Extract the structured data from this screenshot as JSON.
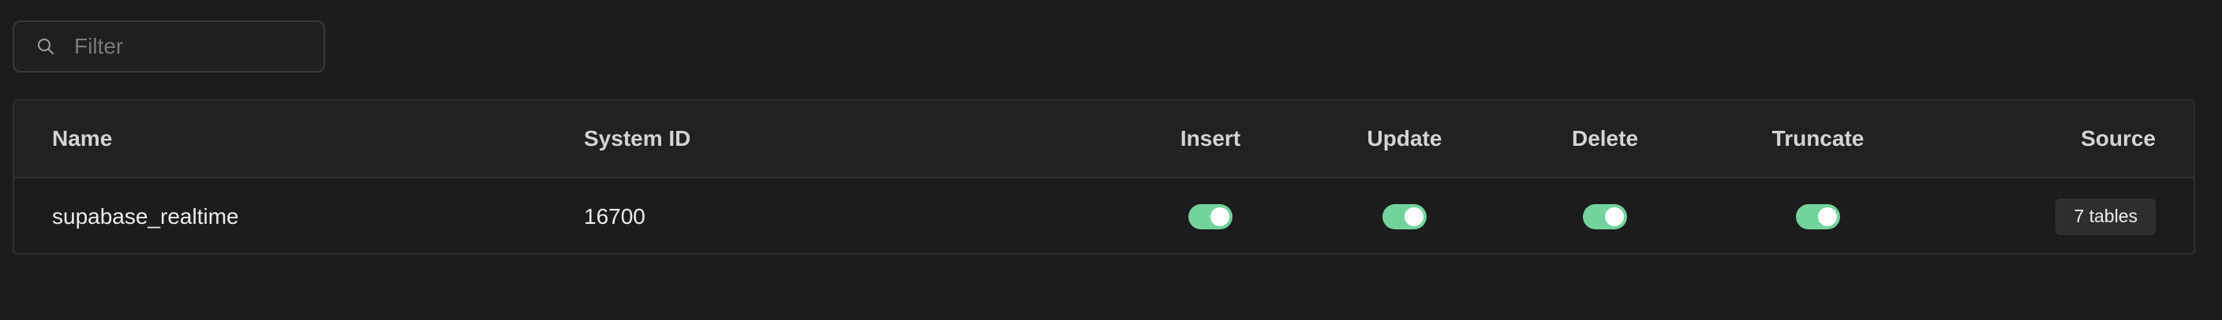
{
  "filter": {
    "placeholder": "Filter",
    "icon": "search-icon"
  },
  "table": {
    "headers": {
      "name": "Name",
      "system_id": "System ID",
      "insert": "Insert",
      "update": "Update",
      "delete": "Delete",
      "truncate": "Truncate",
      "source": "Source"
    },
    "rows": [
      {
        "name": "supabase_realtime",
        "system_id": "16700",
        "insert": true,
        "update": true,
        "delete": true,
        "truncate": true,
        "source": "7 tables"
      }
    ]
  },
  "colors": {
    "background": "#1c1c1c",
    "toggle_on": "#72d39c",
    "border": "#2e2e2e"
  }
}
